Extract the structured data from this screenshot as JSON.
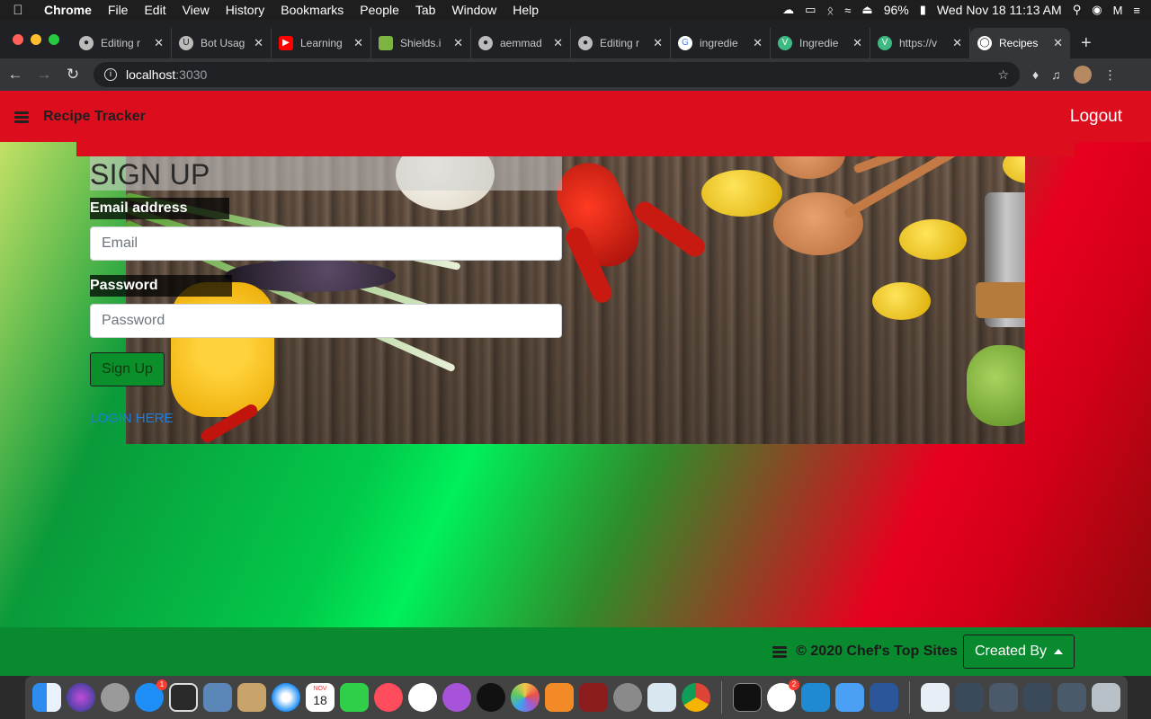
{
  "menubar": {
    "app": "Chrome",
    "items": [
      "File",
      "Edit",
      "View",
      "History",
      "Bookmarks",
      "People",
      "Tab",
      "Window",
      "Help"
    ],
    "battery": "96%",
    "clock": "Wed Nov 18  11:13 AM"
  },
  "tabs": [
    {
      "label": "Editing r",
      "icon": "github-icon"
    },
    {
      "label": "Bot Usag",
      "icon": "bot-icon"
    },
    {
      "label": "Learning",
      "icon": "youtube-icon"
    },
    {
      "label": "Shields.i",
      "icon": "shields-icon"
    },
    {
      "label": "aemmad",
      "icon": "github-icon"
    },
    {
      "label": "Editing r",
      "icon": "github-icon"
    },
    {
      "label": "ingredie",
      "icon": "google-icon"
    },
    {
      "label": "Ingredie",
      "icon": "vue-icon"
    },
    {
      "label": "https://v",
      "icon": "vue-icon"
    },
    {
      "label": "Recipes",
      "icon": "globe-icon",
      "active": true
    }
  ],
  "address": {
    "host": "localhost",
    "port": ":3030"
  },
  "page": {
    "brand": "Recipe Tracker",
    "logout": "Logout",
    "form": {
      "title": "SIGN UP",
      "email_label": "Email address",
      "email_placeholder": "Email",
      "password_label": "Password",
      "password_placeholder": "Password",
      "submit": "Sign Up",
      "login_link": "LOGIN HERE"
    },
    "footer": {
      "copyright": "© 2020 Chef's Top Sites",
      "created_by": "Created By"
    }
  },
  "dock": {
    "calendar_day": "18",
    "calendar_month": "NOV",
    "appstore_badge": "1",
    "slack_badge": "2"
  },
  "colors": {
    "navbar": "#dc0e1e",
    "footer": "#0a8a2e",
    "button": "#0a8f2a",
    "link": "#1a7fe0"
  }
}
